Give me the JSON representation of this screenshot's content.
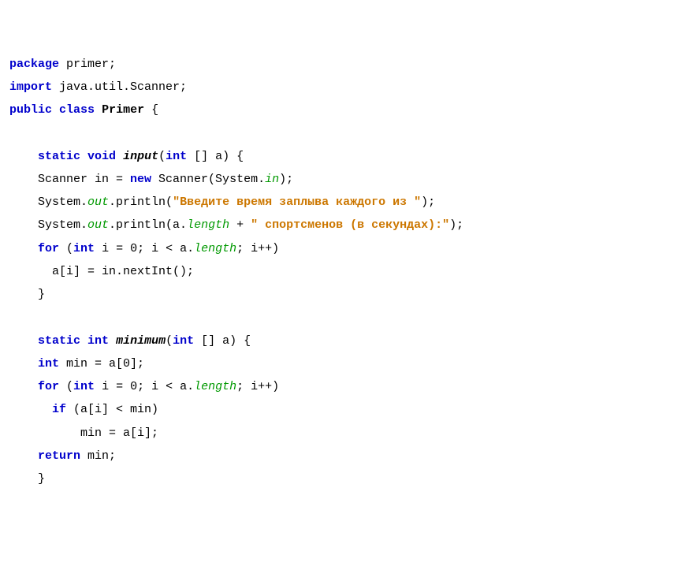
{
  "code": {
    "l1_kw1": "package",
    "l1_txt": " primer;",
    "l2_kw1": "import",
    "l2_txt": " java.util.Scanner;",
    "l3_kw1": "public",
    "l3_kw2": "class",
    "l3_cls": "Primer",
    "l3_txt": " {",
    "l4_kw1": "static",
    "l4_kw2": "void",
    "l4_method": "input",
    "l4_txt1": "(",
    "l4_kw3": "int",
    "l4_txt2": " [] a) {",
    "l5_txt1": "    Scanner in = ",
    "l5_kw1": "new",
    "l5_txt2": " Scanner(System.",
    "l5_sf1": "in",
    "l5_txt3": ");",
    "l6_txt1": "    System.",
    "l6_sf1": "out",
    "l6_txt2": ".println(",
    "l6_str1": "\"Введите время заплыва каждого из \"",
    "l6_txt3": ");",
    "l7_txt1": "    System.",
    "l7_sf1": "out",
    "l7_txt2": ".println(a.",
    "l7_sf2": "length",
    "l7_txt3": " + ",
    "l7_str1": "\" спортсменов (в секундах):\"",
    "l7_txt4": ");",
    "l8_kw1": "for",
    "l8_txt1": " (",
    "l8_kw2": "int",
    "l8_txt2": " i = 0; i < a.",
    "l8_sf1": "length",
    "l8_txt3": "; i++)",
    "l9_txt1": "      a[i] = in.nextInt();",
    "l10_txt": "    }",
    "l11_kw1": "static",
    "l11_kw2": "int",
    "l11_method": "minimum",
    "l11_txt1": "(",
    "l11_kw3": "int",
    "l11_txt2": " [] a) {",
    "l12_kw1": "int",
    "l12_txt1": " min = a[0];",
    "l13_kw1": "for",
    "l13_txt1": " (",
    "l13_kw2": "int",
    "l13_txt2": " i = 0; i < a.",
    "l13_sf1": "length",
    "l13_txt3": "; i++)",
    "l14_kw1": "if",
    "l14_txt1": " (a[i] < min)",
    "l15_txt1": "          min = a[i];",
    "l16_kw1": "return",
    "l16_txt1": " min;",
    "l17_txt": "    }"
  }
}
